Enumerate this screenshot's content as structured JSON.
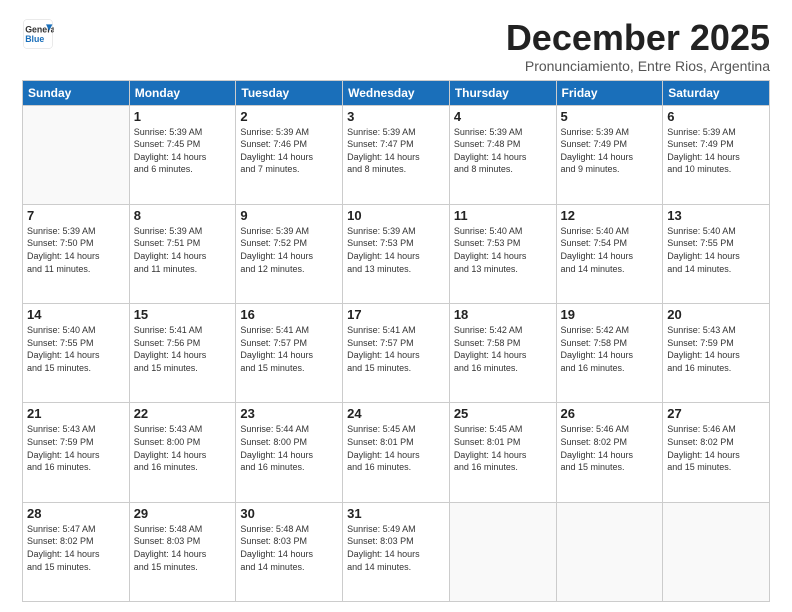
{
  "logo": {
    "general": "General",
    "blue": "Blue"
  },
  "title": "December 2025",
  "subtitle": "Pronunciamiento, Entre Rios, Argentina",
  "headers": [
    "Sunday",
    "Monday",
    "Tuesday",
    "Wednesday",
    "Thursday",
    "Friday",
    "Saturday"
  ],
  "weeks": [
    [
      {
        "day": "",
        "info": ""
      },
      {
        "day": "1",
        "info": "Sunrise: 5:39 AM\nSunset: 7:45 PM\nDaylight: 14 hours\nand 6 minutes."
      },
      {
        "day": "2",
        "info": "Sunrise: 5:39 AM\nSunset: 7:46 PM\nDaylight: 14 hours\nand 7 minutes."
      },
      {
        "day": "3",
        "info": "Sunrise: 5:39 AM\nSunset: 7:47 PM\nDaylight: 14 hours\nand 8 minutes."
      },
      {
        "day": "4",
        "info": "Sunrise: 5:39 AM\nSunset: 7:48 PM\nDaylight: 14 hours\nand 8 minutes."
      },
      {
        "day": "5",
        "info": "Sunrise: 5:39 AM\nSunset: 7:49 PM\nDaylight: 14 hours\nand 9 minutes."
      },
      {
        "day": "6",
        "info": "Sunrise: 5:39 AM\nSunset: 7:49 PM\nDaylight: 14 hours\nand 10 minutes."
      }
    ],
    [
      {
        "day": "7",
        "info": "Sunrise: 5:39 AM\nSunset: 7:50 PM\nDaylight: 14 hours\nand 11 minutes."
      },
      {
        "day": "8",
        "info": "Sunrise: 5:39 AM\nSunset: 7:51 PM\nDaylight: 14 hours\nand 11 minutes."
      },
      {
        "day": "9",
        "info": "Sunrise: 5:39 AM\nSunset: 7:52 PM\nDaylight: 14 hours\nand 12 minutes."
      },
      {
        "day": "10",
        "info": "Sunrise: 5:39 AM\nSunset: 7:53 PM\nDaylight: 14 hours\nand 13 minutes."
      },
      {
        "day": "11",
        "info": "Sunrise: 5:40 AM\nSunset: 7:53 PM\nDaylight: 14 hours\nand 13 minutes."
      },
      {
        "day": "12",
        "info": "Sunrise: 5:40 AM\nSunset: 7:54 PM\nDaylight: 14 hours\nand 14 minutes."
      },
      {
        "day": "13",
        "info": "Sunrise: 5:40 AM\nSunset: 7:55 PM\nDaylight: 14 hours\nand 14 minutes."
      }
    ],
    [
      {
        "day": "14",
        "info": "Sunrise: 5:40 AM\nSunset: 7:55 PM\nDaylight: 14 hours\nand 15 minutes."
      },
      {
        "day": "15",
        "info": "Sunrise: 5:41 AM\nSunset: 7:56 PM\nDaylight: 14 hours\nand 15 minutes."
      },
      {
        "day": "16",
        "info": "Sunrise: 5:41 AM\nSunset: 7:57 PM\nDaylight: 14 hours\nand 15 minutes."
      },
      {
        "day": "17",
        "info": "Sunrise: 5:41 AM\nSunset: 7:57 PM\nDaylight: 14 hours\nand 15 minutes."
      },
      {
        "day": "18",
        "info": "Sunrise: 5:42 AM\nSunset: 7:58 PM\nDaylight: 14 hours\nand 16 minutes."
      },
      {
        "day": "19",
        "info": "Sunrise: 5:42 AM\nSunset: 7:58 PM\nDaylight: 14 hours\nand 16 minutes."
      },
      {
        "day": "20",
        "info": "Sunrise: 5:43 AM\nSunset: 7:59 PM\nDaylight: 14 hours\nand 16 minutes."
      }
    ],
    [
      {
        "day": "21",
        "info": "Sunrise: 5:43 AM\nSunset: 7:59 PM\nDaylight: 14 hours\nand 16 minutes."
      },
      {
        "day": "22",
        "info": "Sunrise: 5:43 AM\nSunset: 8:00 PM\nDaylight: 14 hours\nand 16 minutes."
      },
      {
        "day": "23",
        "info": "Sunrise: 5:44 AM\nSunset: 8:00 PM\nDaylight: 14 hours\nand 16 minutes."
      },
      {
        "day": "24",
        "info": "Sunrise: 5:45 AM\nSunset: 8:01 PM\nDaylight: 14 hours\nand 16 minutes."
      },
      {
        "day": "25",
        "info": "Sunrise: 5:45 AM\nSunset: 8:01 PM\nDaylight: 14 hours\nand 16 minutes."
      },
      {
        "day": "26",
        "info": "Sunrise: 5:46 AM\nSunset: 8:02 PM\nDaylight: 14 hours\nand 15 minutes."
      },
      {
        "day": "27",
        "info": "Sunrise: 5:46 AM\nSunset: 8:02 PM\nDaylight: 14 hours\nand 15 minutes."
      }
    ],
    [
      {
        "day": "28",
        "info": "Sunrise: 5:47 AM\nSunset: 8:02 PM\nDaylight: 14 hours\nand 15 minutes."
      },
      {
        "day": "29",
        "info": "Sunrise: 5:48 AM\nSunset: 8:03 PM\nDaylight: 14 hours\nand 15 minutes."
      },
      {
        "day": "30",
        "info": "Sunrise: 5:48 AM\nSunset: 8:03 PM\nDaylight: 14 hours\nand 14 minutes."
      },
      {
        "day": "31",
        "info": "Sunrise: 5:49 AM\nSunset: 8:03 PM\nDaylight: 14 hours\nand 14 minutes."
      },
      {
        "day": "",
        "info": ""
      },
      {
        "day": "",
        "info": ""
      },
      {
        "day": "",
        "info": ""
      }
    ]
  ]
}
